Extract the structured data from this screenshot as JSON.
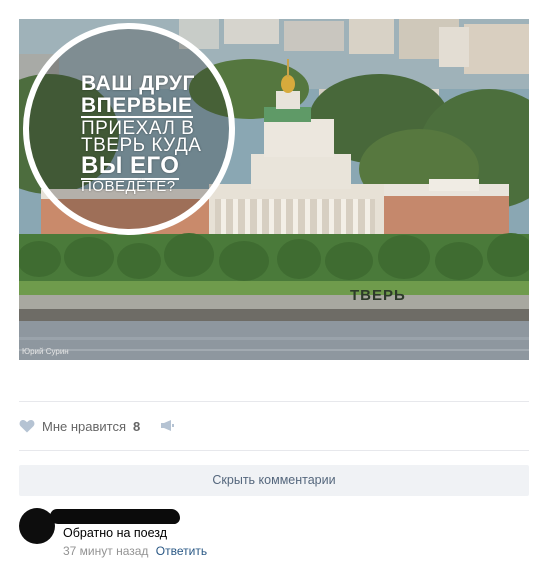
{
  "post": {
    "image": {
      "circle_lines": [
        "ВАШ ДРУГ",
        "ВПЕРВЫЕ",
        "ПРИЕХАЛ В",
        "ТВЕРЬ КУДА",
        "ВЫ ЕГО",
        "ПОВЕДЁТЕ?"
      ],
      "sign_text": "ТВЕРЬ",
      "credit": "Юрий Сурин"
    },
    "actions": {
      "like_label": "Мне нравится",
      "like_count": "8",
      "like_icon": "heart-icon",
      "share_icon": "megaphone-icon"
    }
  },
  "comments": {
    "hide_label": "Скрыть комментарии",
    "items": [
      {
        "text": "Обратно на поезд",
        "time": "37 минут назад",
        "reply_label": "Ответить"
      }
    ]
  },
  "colors": {
    "link": "#2a5885",
    "muted": "#939393",
    "button_bg": "#f0f2f5",
    "button_text": "#55677d"
  }
}
